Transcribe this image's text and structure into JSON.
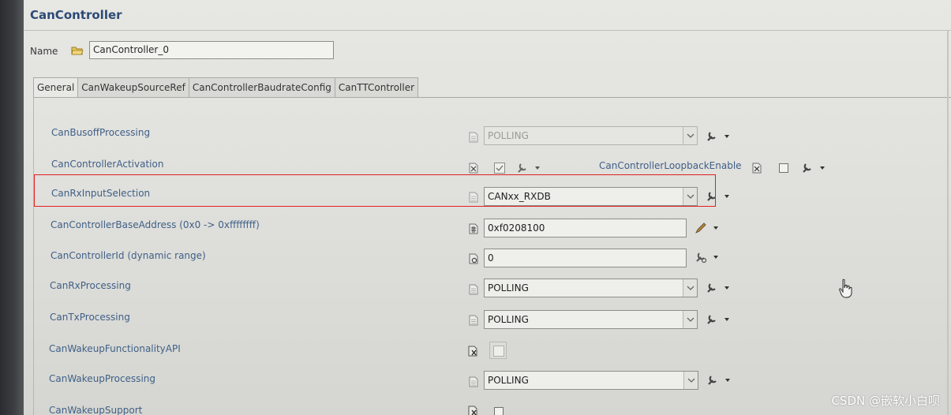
{
  "window": {
    "title": "CanController"
  },
  "name_field": {
    "label": "Name",
    "value": "CanController_0"
  },
  "tabs": [
    {
      "label": "General"
    },
    {
      "label": "CanWakeupSourceRef"
    },
    {
      "label": "CanControllerBaudrateConfig"
    },
    {
      "label": "CanTTController"
    }
  ],
  "params": {
    "busoff": {
      "label": "CanBusoffProcessing",
      "value": "POLLING"
    },
    "activation": {
      "label": "CanControllerActivation"
    },
    "loopback": {
      "label": "CanControllerLoopbackEnable"
    },
    "rx_input": {
      "label": "CanRxInputSelection",
      "value": "CANxx_RXDB"
    },
    "base_address": {
      "label": "CanControllerBaseAddress (0x0 -> 0xffffffff)",
      "value": "0xf0208100"
    },
    "controller_id": {
      "label": "CanControllerId (dynamic range)",
      "value": "0"
    },
    "rx_processing": {
      "label": "CanRxProcessing",
      "value": "POLLING"
    },
    "tx_processing": {
      "label": "CanTxProcessing",
      "value": "POLLING"
    },
    "wakeup_api": {
      "label": "CanWakeupFunctionalityAPI"
    },
    "wakeup_processing": {
      "label": "CanWakeupProcessing",
      "value": "POLLING"
    },
    "wakeup_support": {
      "label": "CanWakeupSupport"
    }
  },
  "watermark": "CSDN @嵌软小白呗",
  "colors": {
    "highlight": "#e02020",
    "label_blue": "#3f5f87",
    "title_blue": "#2c4a76"
  }
}
